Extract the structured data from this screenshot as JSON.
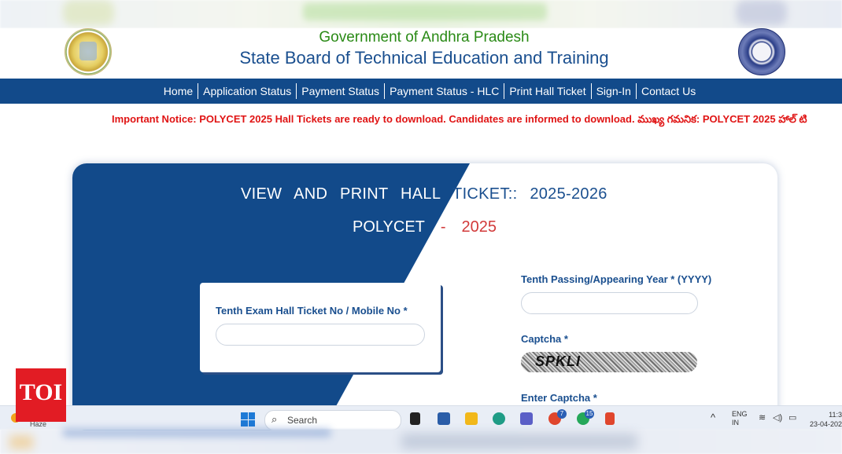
{
  "header": {
    "gov_title": "Government of Andhra Pradesh",
    "board_title": "State Board of Technical Education and Training"
  },
  "nav": {
    "items": [
      {
        "label": "Home"
      },
      {
        "label": "Application Status"
      },
      {
        "label": "Payment Status"
      },
      {
        "label": "Payment Status - HLC"
      },
      {
        "label": "Print Hall Ticket"
      },
      {
        "label": "Sign-In"
      },
      {
        "label": "Contact Us"
      }
    ]
  },
  "notice": {
    "text": "Important Notice: POLYCET 2025 Hall Tickets are ready to download. Candidates are informed to download. ముఖ్య గమనిక: POLYCET 2025 హాల్ టి"
  },
  "form": {
    "title_part1": "VIEW AND PRINT HALL",
    "title_part2": "TICKET::",
    "title_year": "2025-2026",
    "sub_exam": "POLYCET",
    "sub_dash": "-",
    "sub_year": "2025",
    "hall_ticket_label": "Tenth Exam Hall Ticket No / Mobile No  *",
    "hall_ticket_value": "",
    "passing_year_label": "Tenth Passing/Appearing Year  * (YYYY)",
    "passing_year_value": "",
    "captcha_label": "Captcha *",
    "captcha_text": "SPKLI",
    "enter_captcha_label": "Enter Captcha  *"
  },
  "watermark": {
    "text": "TOI"
  },
  "taskbar": {
    "search_placeholder": "Search",
    "weather_text": "Haze",
    "badge_edge": "7",
    "badge_whatsapp": "15",
    "lang_line1": "ENG",
    "lang_line2": "IN",
    "time": "11:3",
    "date": "23-04-202"
  },
  "colors": {
    "nav_bg": "#124a8a",
    "brand_blue": "#1a4f8f",
    "gov_green": "#2a8a16",
    "notice_red": "#e01414",
    "year_red": "#d23a3a"
  }
}
